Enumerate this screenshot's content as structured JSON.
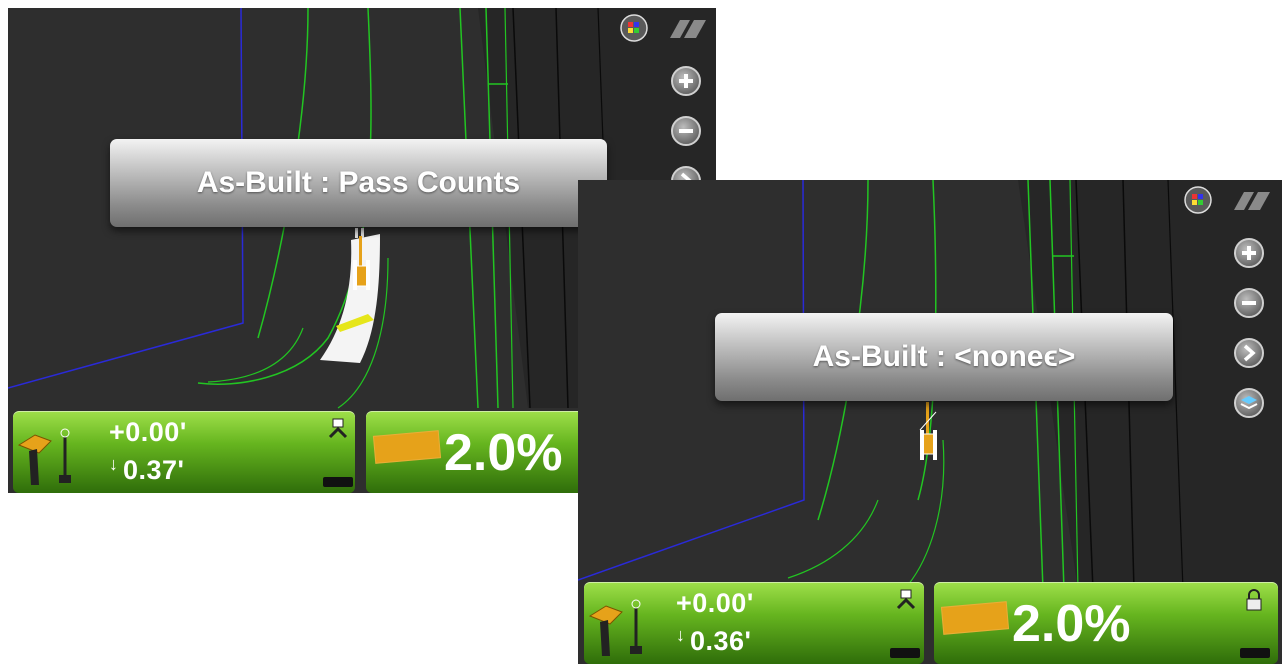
{
  "screens": [
    {
      "banner": "As-Built : Pass Counts",
      "elevation": {
        "offset": "+0.00'",
        "cut_arrow": "↓",
        "cut_value": "0.37'"
      },
      "slope": "2.0%",
      "side_buttons": [
        "zoom-in",
        "zoom-out",
        "next",
        "layers"
      ],
      "top_icons": [
        "map-view-icon",
        "machine-view-icon"
      ]
    },
    {
      "banner": "As-Built : <noneϵ>",
      "elevation": {
        "offset": "+0.00'",
        "cut_arrow": "↓",
        "cut_value": "0.36'"
      },
      "slope": "2.0%",
      "side_buttons": [
        "zoom-in",
        "zoom-out",
        "next",
        "layers"
      ],
      "top_icons": [
        "map-view-icon",
        "machine-view-icon"
      ]
    }
  ],
  "colors": {
    "panel_green": "#66b51f",
    "map_bg": "#2e2e2e",
    "design_line": "#22c522",
    "boundary_line": "#2222cc",
    "blade_orange": "#e6a21a"
  }
}
